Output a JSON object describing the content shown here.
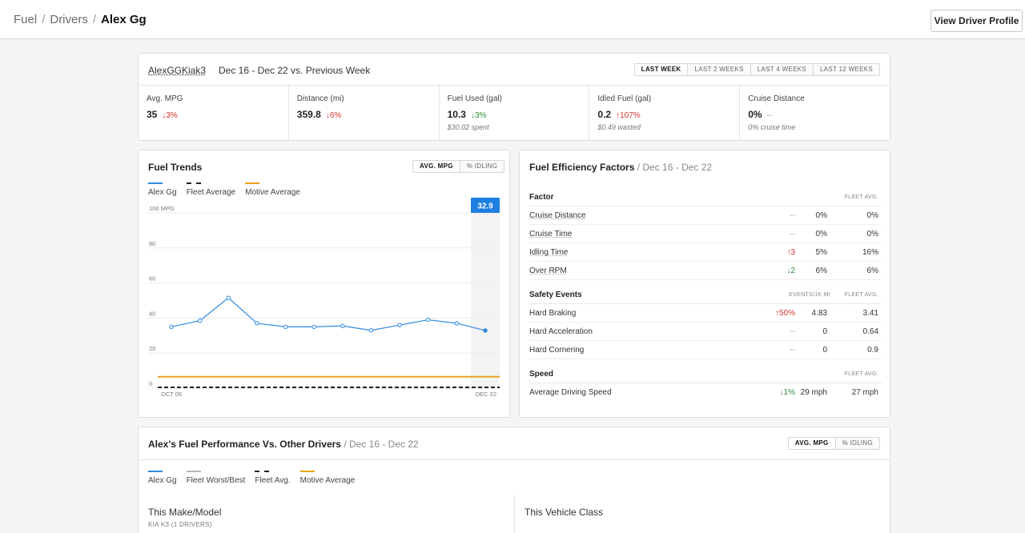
{
  "breadcrumb": {
    "items": [
      "Fuel",
      "Drivers"
    ],
    "current": "Alex Gg"
  },
  "header": {
    "profile_button": "View Driver Profile"
  },
  "summary": {
    "driver_id": "AlexGGKiak3",
    "date_range": "Dec 16 - Dec 22 vs. Previous Week",
    "periods": [
      "LAST WEEK",
      "LAST 2 WEEKS",
      "LAST 4 WEEKS",
      "LAST 12 WEEKS"
    ],
    "active_period": "LAST WEEK",
    "stats": [
      {
        "label": "Avg. MPG",
        "value": "35",
        "change": "↓3%",
        "trend": "red",
        "sub": ""
      },
      {
        "label": "Distance (mi)",
        "value": "359.8",
        "change": "↓6%",
        "trend": "red",
        "sub": ""
      },
      {
        "label": "Fuel Used (gal)",
        "value": "10.3",
        "change": "↓3%",
        "trend": "green",
        "sub": "$30.02 spent"
      },
      {
        "label": "Idled Fuel (gal)",
        "value": "0.2",
        "change": "↑107%",
        "trend": "red",
        "sub": "$0.49 wasted"
      },
      {
        "label": "Cruise Distance",
        "value": "0%",
        "change": "--",
        "trend": "gray",
        "sub": "0% cruise time"
      }
    ]
  },
  "trends": {
    "title": "Fuel Trends",
    "tabs": [
      "AVG. MPG",
      "% IDLING"
    ],
    "active_tab": "AVG. MPG",
    "legend": [
      {
        "label": "Alex Gg",
        "color": "#2f8ae0",
        "style": "solid"
      },
      {
        "label": "Fleet Average",
        "color": "#222222",
        "style": "dashed"
      },
      {
        "label": "Motive Average",
        "color": "#e8a21a",
        "style": "solid"
      }
    ],
    "highlight_value": "32.9"
  },
  "chart_data": {
    "type": "line",
    "ylabel": "",
    "y_tick_labels": [
      "100 MPG",
      "80",
      "60",
      "40",
      "20",
      "0"
    ],
    "y_ticks": [
      100,
      80,
      60,
      40,
      20,
      0
    ],
    "ylim": [
      0,
      100
    ],
    "x_tick_labels": [
      "OCT 06",
      "DEC 22"
    ],
    "grid": true,
    "series": [
      {
        "name": "Alex Gg",
        "color": "#2f8ae0",
        "values": [
          35,
          38.5,
          51.5,
          37,
          35,
          35,
          35.5,
          33,
          36,
          39,
          37,
          32.9
        ]
      },
      {
        "name": "Fleet Average",
        "color": "#222222",
        "values": [
          0,
          0,
          0,
          0,
          0,
          0,
          0,
          0,
          0,
          0,
          0,
          0
        ]
      },
      {
        "name": "Motive Average",
        "color": "#e8a21a",
        "values": [
          6.5,
          6.5,
          6.5,
          6.5,
          6.5,
          6.5,
          6.5,
          6.5,
          6.5,
          6.5,
          6.5,
          6.5
        ]
      }
    ]
  },
  "factors": {
    "title": "Fuel Efficiency Factors",
    "range": "/ Dec 16 - Dec 22",
    "factor_section": {
      "name": "Factor",
      "col1": "",
      "col2": "FLEET AVG.",
      "rows": [
        {
          "name": "Cruise Distance",
          "change": "--",
          "trend": "gray",
          "value": "0%",
          "fleet": "0%"
        },
        {
          "name": "Cruise Time",
          "change": "--",
          "trend": "gray",
          "value": "0%",
          "fleet": "0%"
        },
        {
          "name": "Idling Time",
          "change": "↑3",
          "trend": "red",
          "value": "5%",
          "fleet": "16%"
        },
        {
          "name": "Over RPM",
          "change": "↓2",
          "trend": "green",
          "value": "6%",
          "fleet": "6%"
        }
      ]
    },
    "safety_section": {
      "name": "Safety Events",
      "col1": "EVENTS/1K MI",
      "col2": "FLEET AVG.",
      "rows": [
        {
          "name": "Hard Braking",
          "change": "↑50%",
          "trend": "red",
          "value": "4.83",
          "fleet": "3.41"
        },
        {
          "name": "Hard Acceleration",
          "change": "--",
          "trend": "gray",
          "value": "0",
          "fleet": "0.64"
        },
        {
          "name": "Hard Cornering",
          "change": "--",
          "trend": "gray",
          "value": "0",
          "fleet": "0.9"
        }
      ]
    },
    "speed_section": {
      "name": "Speed",
      "col1": "",
      "col2": "FLEET AVG.",
      "rows": [
        {
          "name": "Average Driving Speed",
          "change": "↓1%",
          "trend": "green",
          "value": "29 mph",
          "fleet": "27 mph"
        }
      ]
    }
  },
  "performance": {
    "title": "Alex's Fuel Performance Vs. Other Drivers",
    "range": "/  Dec 16 - Dec 22",
    "tabs": [
      "AVG. MPG",
      "% IDLING"
    ],
    "active_tab": "AVG. MPG",
    "legend": [
      {
        "label": "Alex Gg",
        "color": "#2f8ae0",
        "style": "solid"
      },
      {
        "label": "Fleet Worst/Best",
        "color": "#b5b5b5",
        "style": "solid"
      },
      {
        "label": "Fleet Avg.",
        "color": "#222222",
        "style": "dashed"
      },
      {
        "label": "Motive Average",
        "color": "#e8a21a",
        "style": "solid"
      }
    ],
    "left_title": "This Make/Model",
    "left_sub": "KIA K3 (1 DRIVERS)",
    "right_title": "This Vehicle Class"
  }
}
